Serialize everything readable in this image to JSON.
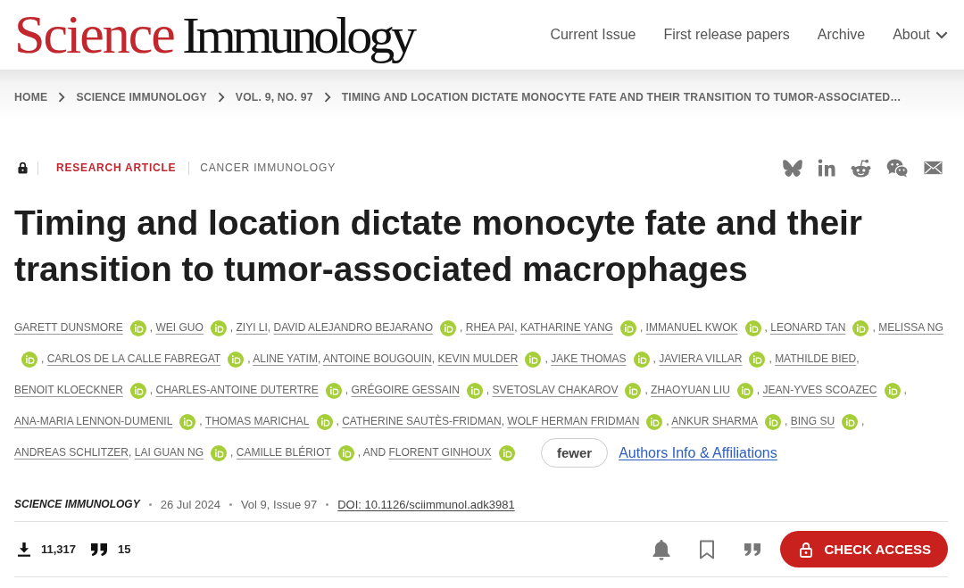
{
  "site_header": {
    "logo": {
      "part_1": "Science",
      "part_2": "Immunology"
    },
    "nav": [
      {
        "label": "Current Issue",
        "dropdown": false
      },
      {
        "label": "First release papers",
        "dropdown": false
      },
      {
        "label": "Archive",
        "dropdown": false
      },
      {
        "label": "About",
        "dropdown": true
      }
    ]
  },
  "breadcrumb": [
    "HOME",
    "SCIENCE IMMUNOLOGY",
    "VOL. 9, NO. 97",
    "TIMING AND LOCATION DICTATE MONOCYTE FATE AND THEIR TRANSITION TO TUMOR-ASSOCIATED…"
  ],
  "article": {
    "article_type": "RESEARCH ARTICLE",
    "subject": "CANCER IMMUNOLOGY",
    "title": "Timing and location dictate monocyte fate and their transition to tumor-associated macrophages",
    "authors": [
      {
        "name": "GARETT DUNSMORE",
        "orcid": true,
        "after": ","
      },
      {
        "name": "WEI GUO",
        "orcid": true,
        "after": ","
      },
      {
        "name": "ZIYI LI",
        "orcid": false,
        "after": ","
      },
      {
        "name": "DAVID ALEJANDRO BEJARANO",
        "orcid": true,
        "after": ","
      },
      {
        "name": "RHEA PAI",
        "orcid": false,
        "after": ","
      },
      {
        "name": "KATHARINE YANG",
        "orcid": true,
        "after": ","
      },
      {
        "name": "IMMANUEL KWOK",
        "orcid": true,
        "after": ","
      },
      {
        "name": "LEONARD TAN",
        "orcid": true,
        "after": ","
      },
      {
        "name": "MELISSA NG",
        "orcid": true,
        "after": ","
      },
      {
        "name": "CARLOS DE LA CALLE FABREGAT",
        "orcid": true,
        "after": ","
      },
      {
        "name": "ALINE YATIM",
        "orcid": false,
        "after": ","
      },
      {
        "name": "ANTOINE BOUGOUIN",
        "orcid": false,
        "after": ","
      },
      {
        "name": "KEVIN MULDER",
        "orcid": true,
        "after": ","
      },
      {
        "name": "JAKE THOMAS",
        "orcid": true,
        "after": ","
      },
      {
        "name": "JAVIERA VILLAR",
        "orcid": true,
        "after": ","
      },
      {
        "name": "MATHILDE BIED",
        "orcid": false,
        "after": ","
      },
      {
        "name": "BENOIT KLOECKNER",
        "orcid": true,
        "after": ","
      },
      {
        "name": "CHARLES-ANTOINE DUTERTRE",
        "orcid": true,
        "after": ","
      },
      {
        "name": "GRÉGOIRE GESSAIN",
        "orcid": true,
        "after": ","
      },
      {
        "name": "SVETOSLAV CHAKAROV",
        "orcid": true,
        "after": ","
      },
      {
        "name": "ZHAOYUAN LIU",
        "orcid": true,
        "after": ","
      },
      {
        "name": "JEAN-YVES SCOAZEC",
        "orcid": true,
        "after": ","
      },
      {
        "name": "ANA-MARIA LENNON-DUMENIL",
        "orcid": true,
        "after": ","
      },
      {
        "name": "THOMAS MARICHAL",
        "orcid": true,
        "after": ","
      },
      {
        "name": "CATHERINE SAUTÈS-FRIDMAN",
        "orcid": false,
        "after": ","
      },
      {
        "name": "WOLF HERMAN FRIDMAN",
        "orcid": true,
        "after": ","
      },
      {
        "name": "ANKUR SHARMA",
        "orcid": true,
        "after": ","
      },
      {
        "name": "BING SU",
        "orcid": true,
        "after": ","
      },
      {
        "name": "ANDREAS SCHLITZER",
        "orcid": false,
        "after": ","
      },
      {
        "name": "LAI GUAN NG",
        "orcid": true,
        "after": ","
      },
      {
        "name": "CAMILLE BLÉRIOT",
        "orcid": true,
        "after": ","
      },
      {
        "before": "AND",
        "name": "FLORENT GINHOUX",
        "orcid": true
      }
    ],
    "fewer_button": "fewer",
    "affiliations_link": "Authors Info & Affiliations",
    "meta": {
      "journal": "SCIENCE IMMUNOLOGY",
      "date": "26 Jul 2024",
      "issue": "Vol 9, Issue 97",
      "doi": "DOI: 10.1126/sciimmunol.adk3981"
    },
    "metrics": [
      {
        "kind": "downloads",
        "value": "11,317"
      },
      {
        "kind": "citations",
        "value": "15"
      }
    ],
    "access_button": "CHECK ACCESS"
  }
}
